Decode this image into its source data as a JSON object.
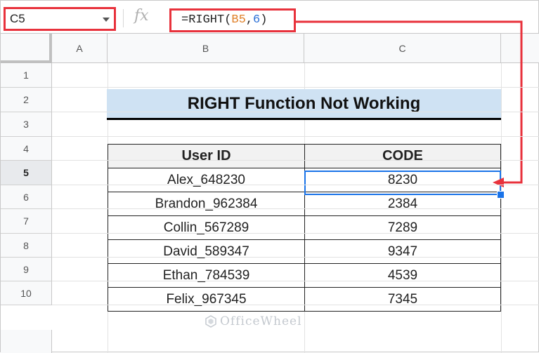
{
  "formula_bar": {
    "name_box": "C5",
    "fx_label": "fx",
    "formula_prefix": "=RIGHT(",
    "formula_ref": "B5",
    "formula_sep": ",",
    "formula_num": "6",
    "formula_suffix": ")"
  },
  "columns": [
    "A",
    "B",
    "C"
  ],
  "rows": [
    "1",
    "2",
    "3",
    "4",
    "5",
    "6",
    "7",
    "8",
    "9",
    "10"
  ],
  "selected_row": "5",
  "sheet": {
    "title": "RIGHT Function Not Working",
    "headers": {
      "user_id": "User ID",
      "code": "CODE"
    },
    "records": [
      {
        "user_id": "Alex_648230",
        "code": "8230"
      },
      {
        "user_id": "Brandon_962384",
        "code": "2384"
      },
      {
        "user_id": "Collin_567289",
        "code": "7289"
      },
      {
        "user_id": "David_589347",
        "code": "9347"
      },
      {
        "user_id": "Ethan_784539",
        "code": "4539"
      },
      {
        "user_id": "Felix_967345",
        "code": "7345"
      }
    ]
  },
  "watermark": "OfficeWheel",
  "colors": {
    "highlight_red": "#e8323c",
    "selection_blue": "#1a73e8",
    "title_fill": "#cfe2f3"
  }
}
